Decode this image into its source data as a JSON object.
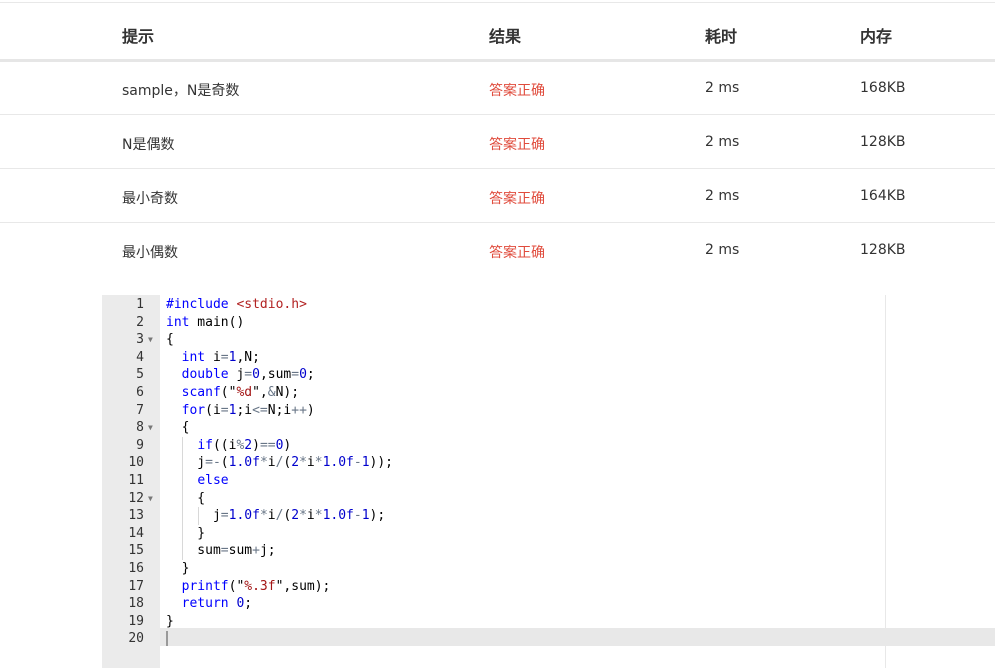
{
  "table": {
    "headers": [
      "提示",
      "结果",
      "耗时",
      "内存"
    ],
    "rows": [
      {
        "hint": "sample，N是奇数",
        "result": "答案正确",
        "time": "2 ms",
        "memory": "168KB"
      },
      {
        "hint": "N是偶数",
        "result": "答案正确",
        "time": "2 ms",
        "memory": "128KB"
      },
      {
        "hint": "最小奇数",
        "result": "答案正确",
        "time": "2 ms",
        "memory": "164KB"
      },
      {
        "hint": "最小偶数",
        "result": "答案正确",
        "time": "2 ms",
        "memory": "128KB"
      }
    ]
  },
  "editor": {
    "line_numbers": [
      "1",
      "2",
      "3",
      "4",
      "5",
      "6",
      "7",
      "8",
      "9",
      "10",
      "11",
      "12",
      "13",
      "14",
      "15",
      "16",
      "17",
      "18",
      "19",
      "20"
    ],
    "fold_marker": "▼",
    "lines": [
      "#include <stdio.h>",
      "int main()",
      "{",
      "  int i=1,N;",
      "  double j=0,sum=0;",
      "  scanf(\"%d\",&N);",
      "  for(i=1;i<=N;i++)",
      "  {",
      "    if((i%2)==0)",
      "    j=-(1.0f*i/(2*i*1.0f-1));",
      "    else",
      "    {",
      "      j=1.0f*i/(2*i*1.0f-1);",
      "    }",
      "    sum=sum+j;",
      "  }",
      "  printf(\"%.3f\",sum);",
      "  return 0;",
      "}",
      ""
    ]
  },
  "colors": {
    "verdict_accepted": "#e04b3c",
    "gutter_bg": "#ebebeb",
    "keyword": "#0000ff"
  }
}
